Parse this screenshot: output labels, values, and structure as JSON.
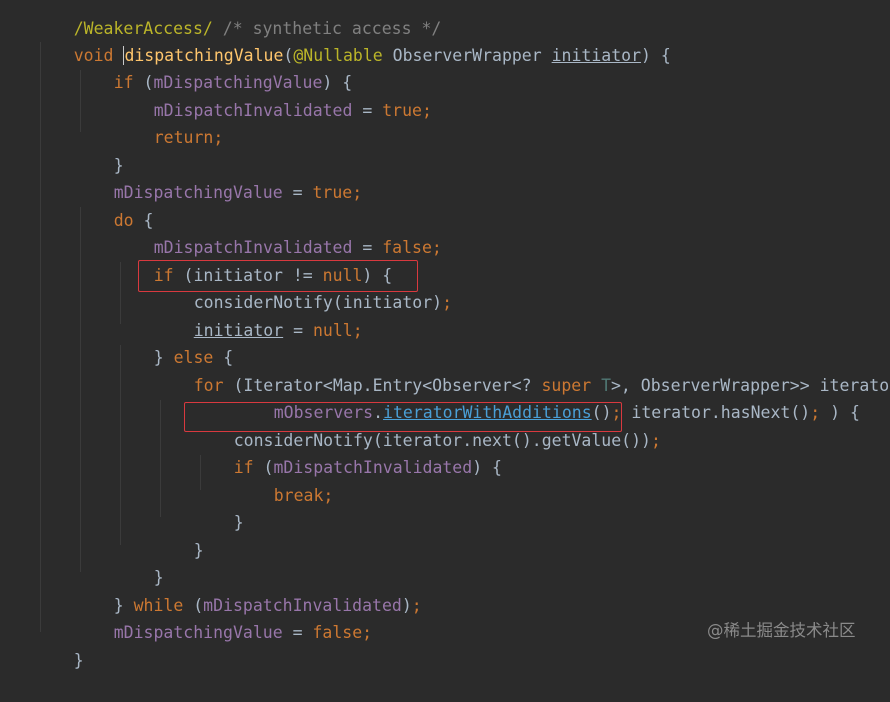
{
  "code": {
    "line_0": {
      "annotation": "/WeakerAccess/",
      "comment": "/* synthetic access */"
    },
    "line_1": {
      "kw_void": "void",
      "method_name": "dispatchingValue",
      "open_paren": "(",
      "annotation": "@Nullable",
      "param_type": " ObserverWrapper ",
      "param_name": "initiator",
      "close": ") {"
    },
    "line_2": {
      "kw": "if",
      "rest": " (",
      "field": "mDispatchingValue",
      "close": ") {"
    },
    "line_3": {
      "field": "mDispatchInvalidated",
      "op": " = ",
      "value": "true",
      "semi": ";"
    },
    "line_4": {
      "kw": "return",
      "semi": ";"
    },
    "line_5": {
      "text": "}"
    },
    "line_6": {
      "field": "mDispatchingValue",
      "op": " = ",
      "value": "true",
      "semi": ";"
    },
    "line_7": {
      "kw": "do",
      "rest": " {"
    },
    "line_8": {
      "field": "mDispatchInvalidated",
      "op": " = ",
      "value": "false",
      "semi": ";"
    },
    "line_9": {
      "kw": "if",
      "mid": " (initiator != ",
      "kw2": "null",
      "close": ") {"
    },
    "line_10": {
      "text": "considerNotify(initiator)",
      "semi": ";"
    },
    "line_11": {
      "var": "initiator",
      "op": " = ",
      "value": "null",
      "semi": ";"
    },
    "line_12": {
      "pre": "} ",
      "kw": "else",
      "rest": " {"
    },
    "line_13": {
      "kw": "for",
      "a": " (Iterator<Map.Entry<Observer<? ",
      "kw2": "super",
      "sp": " ",
      "tparam": "T",
      "b": ">, ObserverWrapper>> iterator = "
    },
    "line_14": {
      "field": "mObservers",
      "dot": ".",
      "method": "iteratorWithAdditions",
      "c": "()",
      "semi1": ";",
      "mid": " iterator.hasNext()",
      "semi2": ";",
      "close": " ) {"
    },
    "line_15": {
      "text": "considerNotify(iterator.next().getValue())",
      "semi": ";"
    },
    "line_16": {
      "kw": "if",
      "rest": " (",
      "field": "mDispatchInvalidated",
      "close": ") {"
    },
    "line_17": {
      "kw": "break",
      "semi": ";"
    },
    "line_18": {
      "text": "}"
    },
    "line_19": {
      "text": "}"
    },
    "line_20": {
      "text": "}"
    },
    "line_21": {
      "pre": "} ",
      "kw": "while",
      "rest": " (",
      "field": "mDispatchInvalidated",
      "close": ")",
      "semi": ";"
    },
    "line_22": {
      "field": "mDispatchingValue",
      "op": " = ",
      "value": "false",
      "semi": ";"
    },
    "line_23": {
      "text": "}"
    }
  },
  "watermark": "@稀土掘金技术社区"
}
